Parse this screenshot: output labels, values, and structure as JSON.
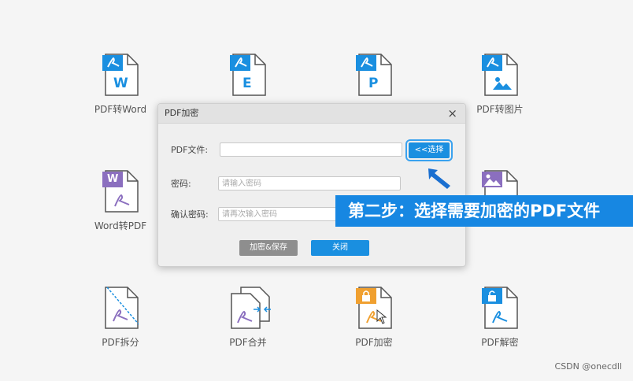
{
  "tools": {
    "pdf_to_word": "PDF转Word",
    "pdf_to_excel": "",
    "pdf_to_ppt": "",
    "pdf_to_image": "PDF转图片",
    "word_to_pdf": "Word转PDF",
    "image_to_pdf": "",
    "pdf_split": "PDF拆分",
    "pdf_merge": "PDF合并",
    "pdf_encrypt": "PDF加密",
    "pdf_decrypt": "PDF解密"
  },
  "badges": {
    "word": "W",
    "excel": "E",
    "ppt": "P",
    "word_to_pdf": "W"
  },
  "dialog": {
    "title": "PDF加密",
    "close": "×",
    "file_label": "PDF文件:",
    "file_value": "",
    "select_button": "<<选择",
    "password_label": "密码:",
    "password_placeholder": "请输入密码",
    "confirm_label": "确认密码:",
    "confirm_placeholder": "请再次输入密码",
    "encrypt_button": "加密&保存",
    "close_button": "关闭"
  },
  "banner": "第二步：选择需要加密的PDF文件",
  "watermark": "CSDN @onecdll",
  "colors": {
    "blue": "#1a8fe0",
    "purple": "#8b6fbf",
    "orange": "#f0a030"
  }
}
